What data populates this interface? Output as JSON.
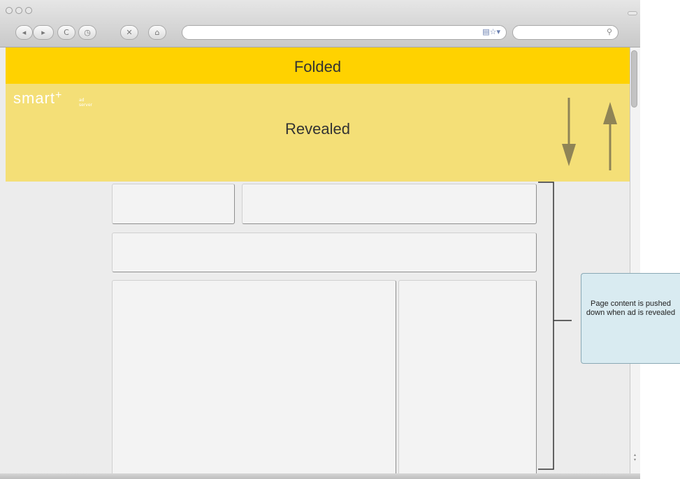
{
  "browser": {
    "nav_buttons": [
      "◂",
      "▸",
      "C",
      "◷",
      "✕",
      "⌂"
    ],
    "url_value": "",
    "bookmark_icons": "▤☆▾",
    "search_icon": "⚲"
  },
  "ad": {
    "folded_label": "Folded",
    "brand": "smart",
    "brand_mark": "+",
    "brand_sub": "ad\nserver",
    "revealed_label": "Revealed",
    "arrow_down": "down-arrow-icon",
    "arrow_up": "up-arrow-icon"
  },
  "annotation": {
    "text": "Page content is pushed down when ad is revealed"
  },
  "colors": {
    "folded_bg": "#ffd200",
    "revealed_bg": "#f4df77",
    "arrow_color": "#8f8456",
    "callout_bg": "#d9ebf1"
  }
}
